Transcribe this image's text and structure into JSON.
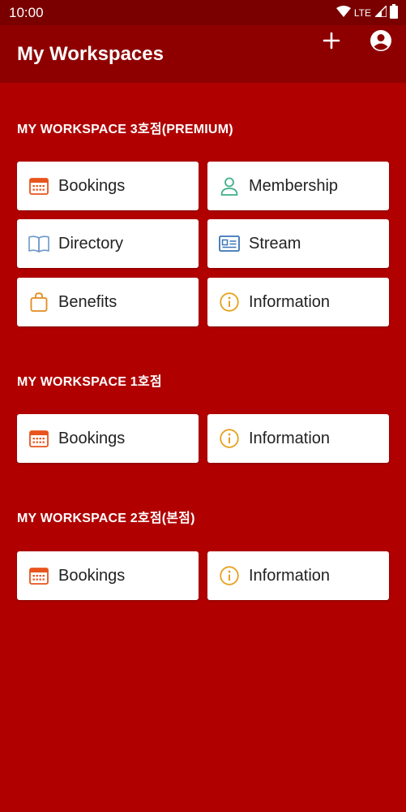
{
  "status_bar": {
    "time": "10:00",
    "network": "LTE"
  },
  "app_bar": {
    "title": "My Workspaces"
  },
  "colors": {
    "background": "#b00000",
    "app_bar": "#8e0000",
    "status_bar": "#7a0000",
    "tile": "#ffffff"
  },
  "sections": [
    {
      "title": "MY WORKSPACE 3호점(PREMIUM)",
      "tiles": [
        {
          "label": "Bookings",
          "icon": "calendar-icon",
          "icon_color": "#e8541c"
        },
        {
          "label": "Membership",
          "icon": "person-icon",
          "icon_color": "#3fae8a"
        },
        {
          "label": "Directory",
          "icon": "book-icon",
          "icon_color": "#6d97c9"
        },
        {
          "label": "Stream",
          "icon": "id-card-icon",
          "icon_color": "#3a73b8"
        },
        {
          "label": "Benefits",
          "icon": "bag-icon",
          "icon_color": "#e28c1e"
        },
        {
          "label": "Information",
          "icon": "info-icon",
          "icon_color": "#e6a11c"
        }
      ]
    },
    {
      "title": "MY WORKSPACE 1호점",
      "tiles": [
        {
          "label": "Bookings",
          "icon": "calendar-icon",
          "icon_color": "#e8541c"
        },
        {
          "label": "Information",
          "icon": "info-icon",
          "icon_color": "#e6a11c"
        }
      ]
    },
    {
      "title": "MY WORKSPACE 2호점(본점)",
      "tiles": [
        {
          "label": "Bookings",
          "icon": "calendar-icon",
          "icon_color": "#e8541c"
        },
        {
          "label": "Information",
          "icon": "info-icon",
          "icon_color": "#e6a11c"
        }
      ]
    }
  ]
}
